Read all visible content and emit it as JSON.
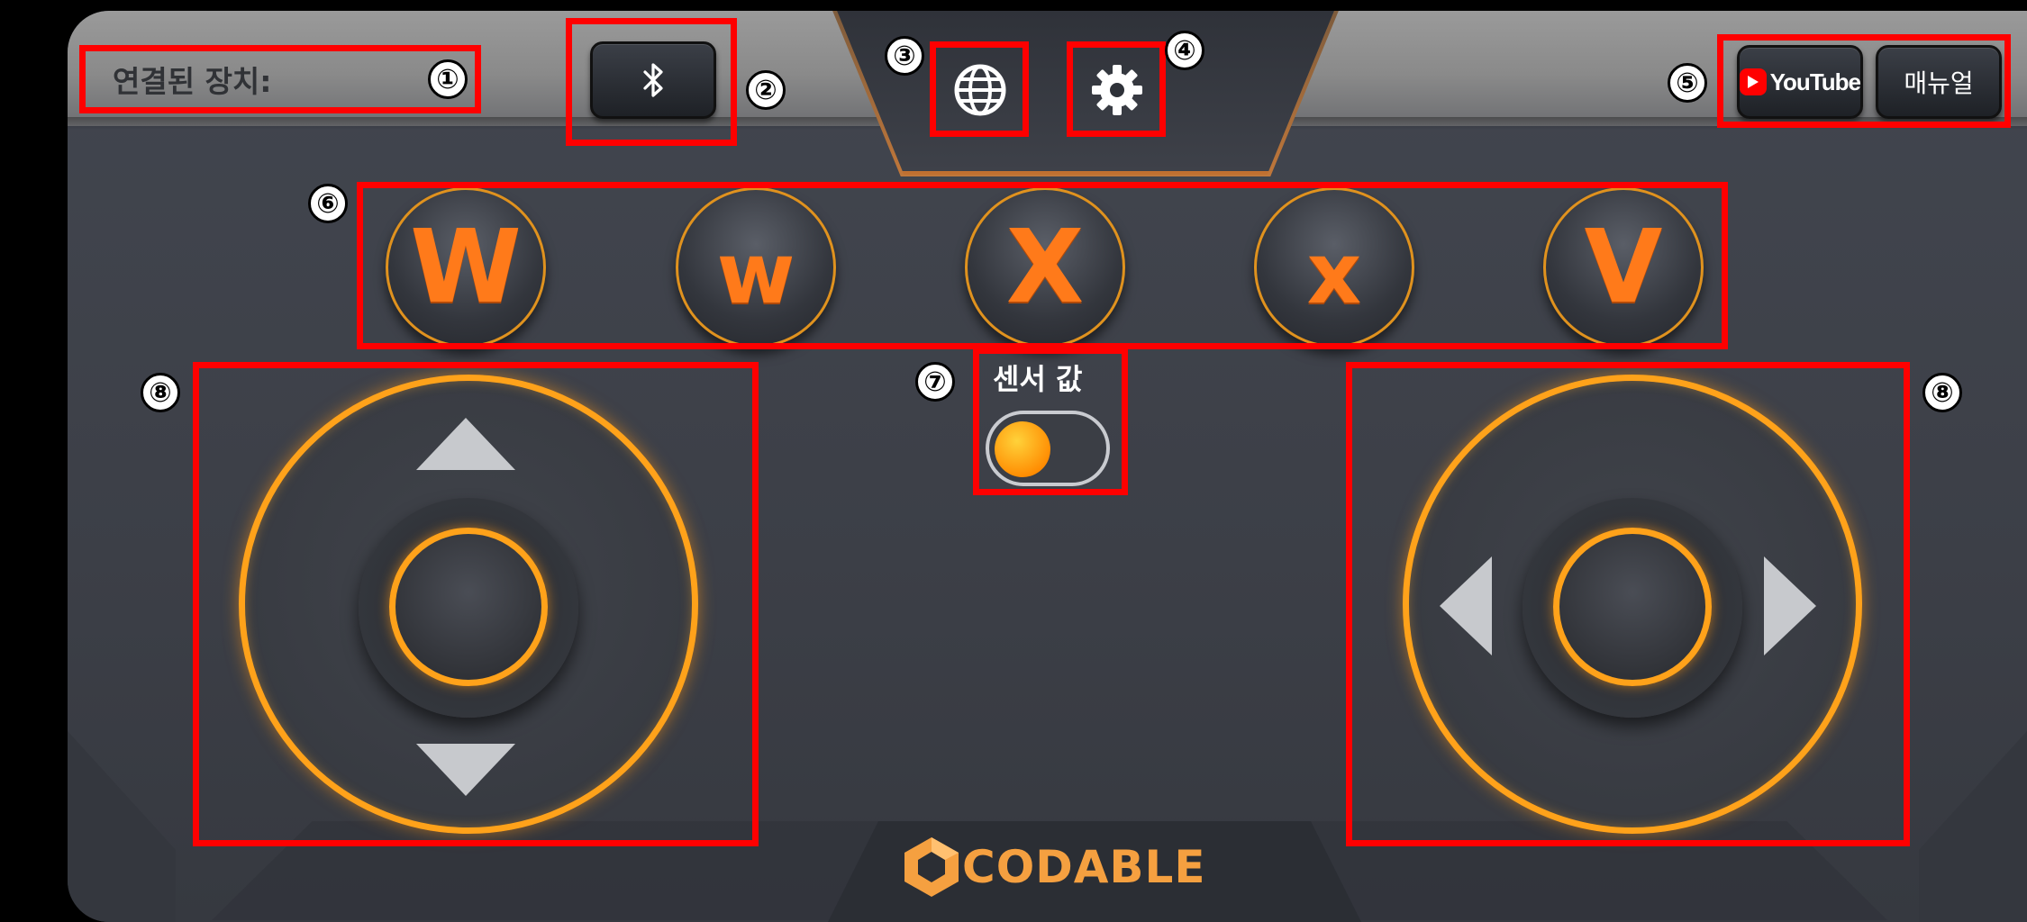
{
  "header": {
    "connected_device_label": "연결된 장치:",
    "bluetooth_icon": "bluetooth-icon",
    "globe_icon": "globe-icon",
    "settings_icon": "gear-icon",
    "youtube_label": "YouTube",
    "manual_label": "매뉴얼"
  },
  "letter_buttons": [
    "W",
    "w",
    "X",
    "x",
    "V"
  ],
  "sensor": {
    "label": "센서 값",
    "toggle_on": false
  },
  "joysticks": {
    "left": {
      "arrows": [
        "up",
        "down"
      ]
    },
    "right": {
      "arrows": [
        "left",
        "right"
      ]
    }
  },
  "brand": {
    "name": "CODABLE"
  },
  "annotations": [
    "①",
    "②",
    "③",
    "④",
    "⑤",
    "⑥",
    "⑦",
    "⑧",
    "⑧"
  ],
  "colors": {
    "accent_orange": "#ff7a1a",
    "ring_orange": "#ffa21a",
    "highlight_red": "#ff0000",
    "youtube_red": "#ff0000"
  }
}
